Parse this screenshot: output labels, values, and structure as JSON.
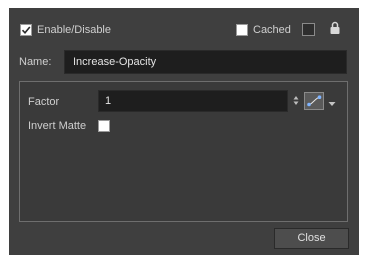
{
  "header": {
    "enable_label": "Enable/Disable",
    "enable_checked": true,
    "cached_label": "Cached",
    "cached_checked": false
  },
  "name": {
    "label": "Name:",
    "value": "Increase-Opacity"
  },
  "params": {
    "factor_label": "Factor",
    "factor_value": "1",
    "invert_matte_label": "Invert Matte",
    "invert_matte_checked": false
  },
  "footer": {
    "close_label": "Close"
  },
  "colors": {
    "dialog_bg": "#3f3f3f",
    "field_bg": "#1e1e1e",
    "text": "#cfcfcf",
    "accent": "#7fb4ff"
  },
  "icons": {
    "lock": "lock-icon",
    "function_curve": "function-curve-icon",
    "spinner": "spinner-arrows-icon",
    "dropdown": "chevron-down-icon"
  }
}
